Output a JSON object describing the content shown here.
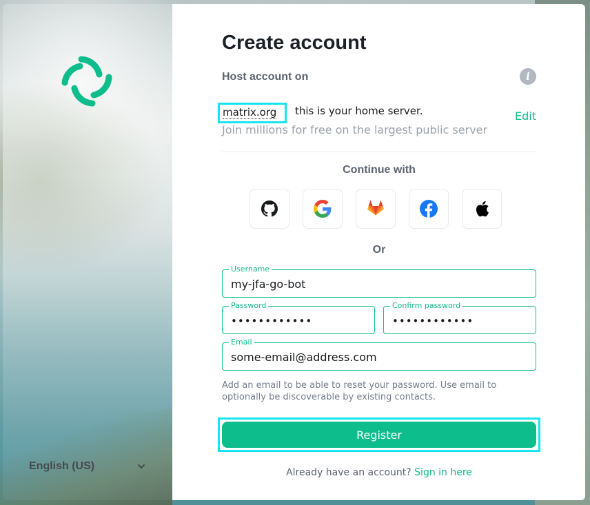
{
  "brand": {
    "accent": "#0dbd8b",
    "highlight": "#17e4f2",
    "logo_icon": "element-logo-icon"
  },
  "language": {
    "selected": "English (US)",
    "icon": "chevron-down-icon"
  },
  "form": {
    "title": "Create account",
    "host_label": "Host account on",
    "info_icon": "info-icon",
    "server_name": "matrix.org",
    "server_desc": "this is your home server.",
    "server_sub": "Join millions for free on the largest public server",
    "edit_label": "Edit",
    "continue_label": "Continue with",
    "sso_providers": [
      {
        "name": "GitHub",
        "icon": "github-icon"
      },
      {
        "name": "Google",
        "icon": "google-icon"
      },
      {
        "name": "GitLab",
        "icon": "gitlab-icon"
      },
      {
        "name": "Facebook",
        "icon": "facebook-icon"
      },
      {
        "name": "Apple",
        "icon": "apple-icon"
      }
    ],
    "or_label": "Or",
    "username": {
      "label": "Username",
      "value": "my-jfa-go-bot"
    },
    "password": {
      "label": "Password",
      "value": "••••••••••••"
    },
    "confirm_password": {
      "label": "Confirm password",
      "value": "••••••••••••"
    },
    "email": {
      "label": "Email",
      "value": "some-email@address.com"
    },
    "help_text": "Add an email to be able to reset your password. Use email to optionally be discoverable by existing contacts.",
    "register_label": "Register",
    "already_text": "Already have an account?",
    "sign_in_label": "Sign in here"
  }
}
